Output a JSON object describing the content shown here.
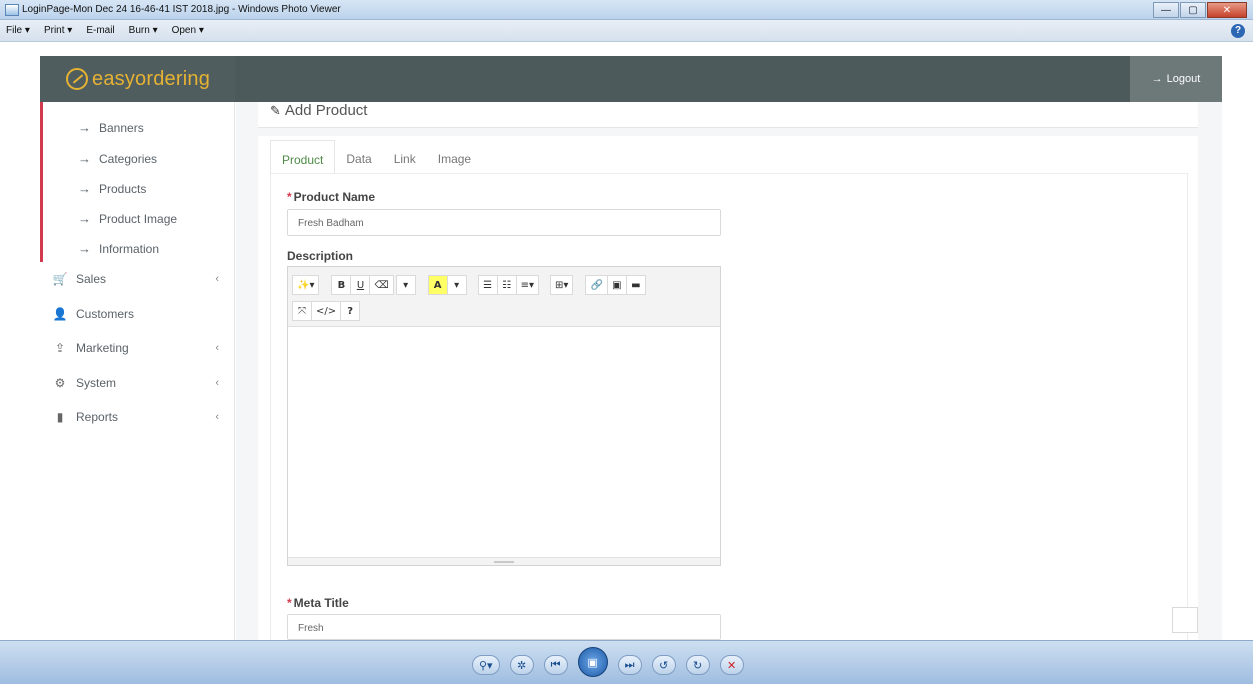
{
  "window": {
    "title": "LoginPage-Mon Dec 24 16-46-41 IST 2018.jpg - Windows Photo Viewer",
    "controls": {
      "minimize": "—",
      "maximize": "▢",
      "close": "✕"
    },
    "menu": [
      {
        "label": "File",
        "caret": "▾"
      },
      {
        "label": "Print",
        "caret": "▾"
      },
      {
        "label": "E-mail",
        "caret": ""
      },
      {
        "label": "Burn",
        "caret": "▾"
      },
      {
        "label": "Open",
        "caret": "▾"
      }
    ],
    "help": "?"
  },
  "app": {
    "brand": "easyordering",
    "logout_label": "Logout",
    "logout_icon": "→"
  },
  "sidebar": {
    "sub_items": [
      {
        "label": "Banners",
        "arrow": "→"
      },
      {
        "label": "Categories",
        "arrow": "→"
      },
      {
        "label": "Products",
        "arrow": "→"
      },
      {
        "label": "Product Image",
        "arrow": "→"
      },
      {
        "label": "Information",
        "arrow": "→"
      }
    ],
    "items": [
      {
        "label": "Sales",
        "icon": "🛒",
        "caret": "‹"
      },
      {
        "label": "Customers",
        "icon": "👤",
        "caret": ""
      },
      {
        "label": "Marketing",
        "icon": "⇪",
        "caret": "‹"
      },
      {
        "label": "System",
        "icon": "⚙",
        "caret": "‹"
      },
      {
        "label": "Reports",
        "icon": "▮",
        "caret": "‹"
      }
    ]
  },
  "panel": {
    "title": "Add Product",
    "title_icon": "✎"
  },
  "tabs": [
    {
      "label": "Product",
      "active": true
    },
    {
      "label": "Data",
      "active": false
    },
    {
      "label": "Link",
      "active": false
    },
    {
      "label": "Image",
      "active": false
    }
  ],
  "form": {
    "product_name": {
      "label": "Product Name",
      "required": "*",
      "value": "Fresh Badham"
    },
    "description": {
      "label": "Description"
    },
    "meta_title": {
      "label": "Meta Title",
      "required": "*",
      "value": "Fresh"
    }
  },
  "editor_toolbar": {
    "row1": [
      "✨▾",
      "B",
      "U",
      "⌫",
      "▾",
      "A",
      "▾",
      "☰",
      "☷",
      "≡▾",
      "⊞▾",
      "🔗",
      "▣",
      "▬"
    ],
    "row2": [
      "⤧",
      "</>",
      "?"
    ]
  },
  "viewer_bar": {
    "buttons": [
      "⚲▾",
      "✲",
      "⏮",
      "▣",
      "⏭",
      "↺",
      "↻",
      "✕"
    ]
  },
  "colors": {
    "header_bg": "#4d5a5b",
    "brand_accent": "#e5b233",
    "active_tab": "#4e8a46",
    "required": "#d23b4d"
  }
}
